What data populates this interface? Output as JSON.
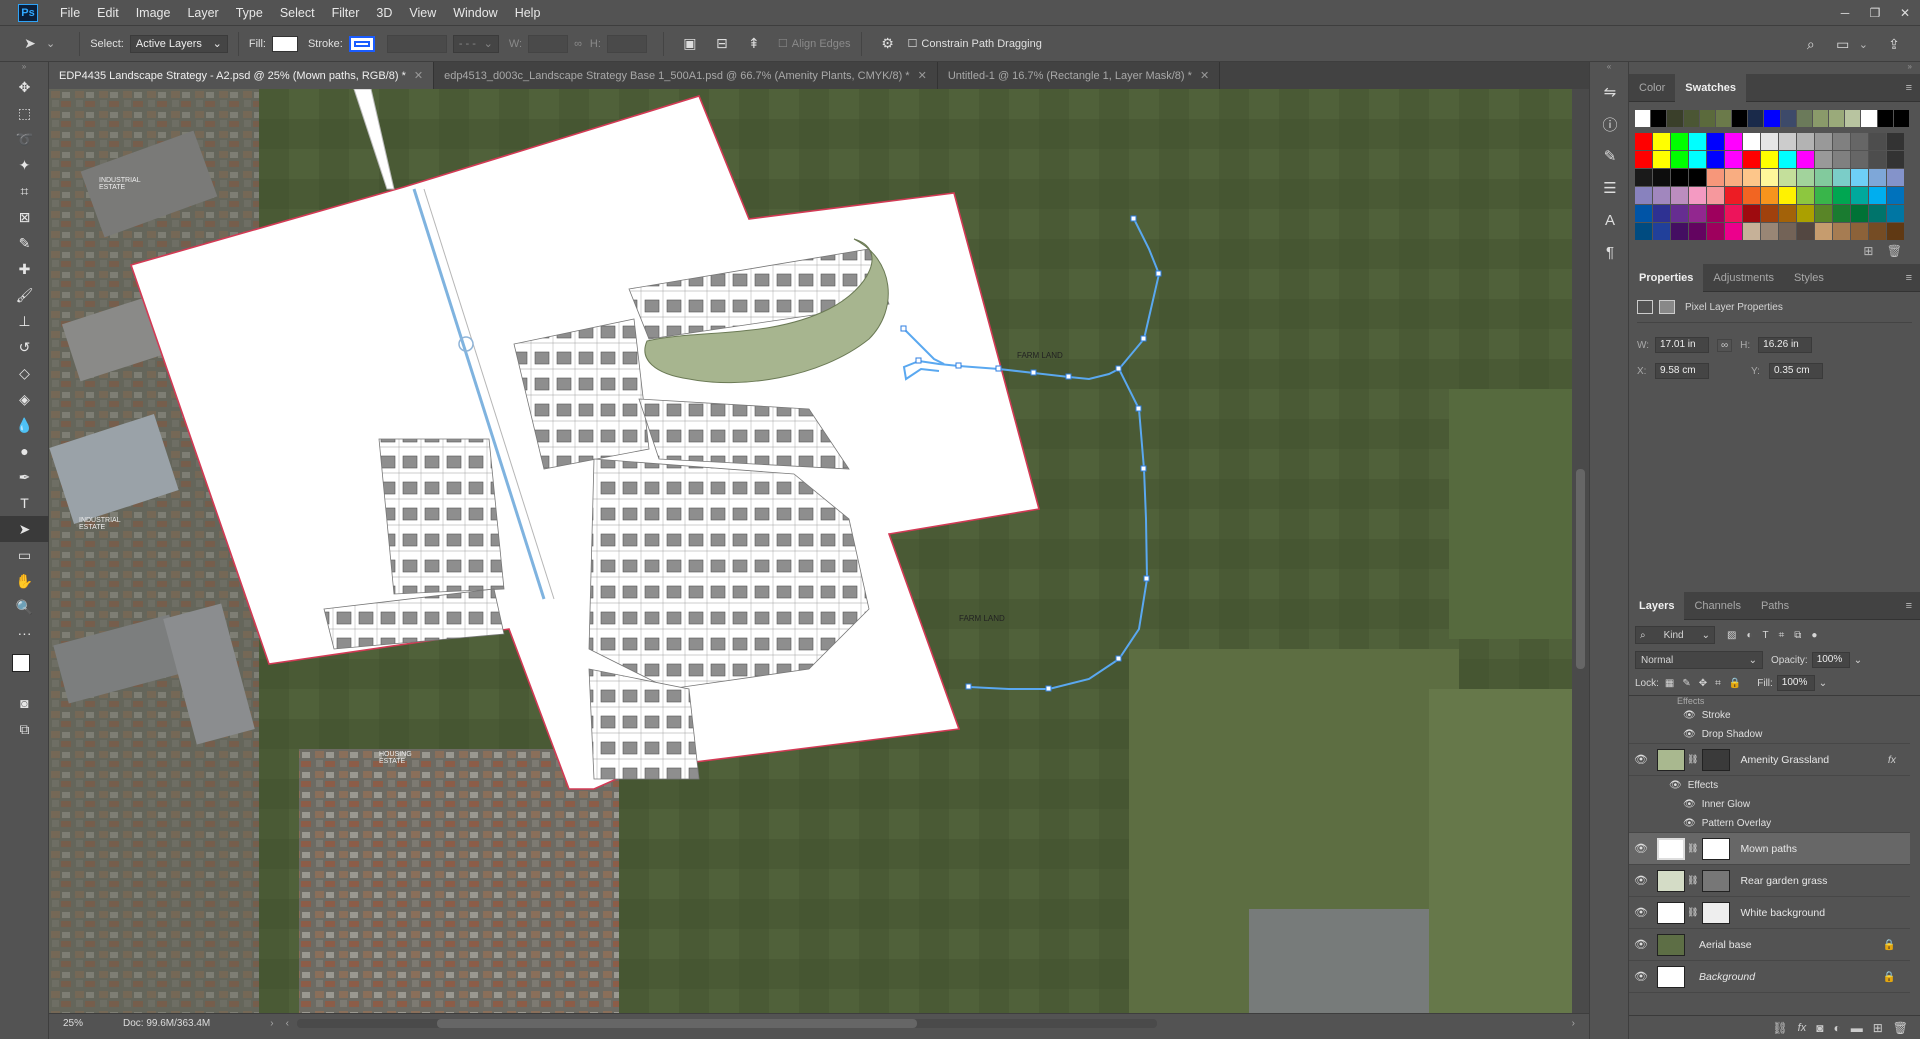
{
  "app": {
    "logo": "Ps",
    "menu": [
      "File",
      "Edit",
      "Image",
      "Layer",
      "Type",
      "Select",
      "Filter",
      "3D",
      "View",
      "Window",
      "Help"
    ]
  },
  "window_controls": {
    "minimize": "─",
    "restore": "❐",
    "close": "✕"
  },
  "options_bar": {
    "select_label": "Select:",
    "select_value": "Active Layers",
    "fill_label": "Fill:",
    "stroke_label": "Stroke:",
    "w_label": "W:",
    "h_label": "H:",
    "align_edges": "Align Edges",
    "constrain": "Constrain Path Dragging"
  },
  "tabs": [
    {
      "label": "EDP4435 Landscape Strategy - A2.psd @ 25% (Mown paths, RGB/8) *",
      "active": true
    },
    {
      "label": "edp4513_d003c_Landscape Strategy Base 1_500A1.psd @ 66.7% (Amenity Plants, CMYK/8) *",
      "active": false
    },
    {
      "label": "Untitled-1 @ 16.7% (Rectangle 1, Layer Mask/8) *",
      "active": false
    }
  ],
  "status": {
    "zoom": "25%",
    "doc": "Doc: 99.6M/363.4M"
  },
  "canvas_labels": {
    "farm_land_1": "FARM LAND",
    "farm_land_2": "FARM LAND",
    "industrial_1": "INDUSTRIAL ESTATE",
    "industrial_2": "INDUSTRIAL ESTATE",
    "housing": "HOUSING ESTATE"
  },
  "panel_top": {
    "tabs": [
      "Color",
      "Swatches"
    ],
    "active": "Swatches"
  },
  "swatches": {
    "row0": [
      "#ffffff",
      "#000000",
      "#3a3f2a",
      "#4b5634",
      "#5b6a3c",
      "#6b7a4a",
      "#000000",
      "#1a2a4a",
      "#0000ff",
      "#3d4a6a",
      "#6b7a5a",
      "#8a9a6a",
      "#9aaa7a",
      "#b8c4a0",
      "#ffffff",
      "#000000",
      "#000000"
    ],
    "row1": [
      "#ff0000",
      "#ffff00",
      "#00ff00",
      "#00ffff",
      "#0000ff",
      "#ff00ff",
      "#ffffff",
      "#e6e6e6",
      "#cccccc",
      "#b3b3b3",
      "#999999",
      "#808080",
      "#666666",
      "#4d4d4d",
      "#333333"
    ],
    "row2": [
      "#ff0000",
      "#ffff00",
      "#00ff00",
      "#00ffff",
      "#0000ff",
      "#ff00ff",
      "#ff0000",
      "#ffff00",
      "#00ffff",
      "#ff00ff",
      "#999999",
      "#808080",
      "#666666",
      "#4d4d4d",
      "#333333"
    ],
    "row3": [
      "#1a1a1a",
      "#0d0d0d",
      "#000000",
      "#000000",
      "#f7977a",
      "#f9ad81",
      "#fdc68a",
      "#fff79a",
      "#c4df9b",
      "#a2d39c",
      "#82ca9d",
      "#7bcdc8",
      "#6ecff6",
      "#7ea7d8",
      "#8493ca"
    ],
    "row4": [
      "#8882be",
      "#a187be",
      "#bc8dbf",
      "#f49ac2",
      "#f6989d",
      "#ed1c24",
      "#f26522",
      "#f7941d",
      "#fff200",
      "#8dc73f",
      "#39b54a",
      "#00a651",
      "#00a99d",
      "#00aeef",
      "#0072bc"
    ],
    "row5": [
      "#0054a6",
      "#2e3192",
      "#662d91",
      "#92278f",
      "#9e005d",
      "#ed145b",
      "#9e0b0f",
      "#a0410d",
      "#a36209",
      "#aba000",
      "#598527",
      "#1a7b30",
      "#007236",
      "#00746b",
      "#0076a3"
    ],
    "row6": [
      "#004b80",
      "#21409a",
      "#440e62",
      "#630460",
      "#9e005d",
      "#ec008c",
      "#c6b198",
      "#998675",
      "#736357",
      "#534741",
      "#c69c6e",
      "#a67c52",
      "#8c6239",
      "#754c24",
      "#603913"
    ]
  },
  "properties": {
    "tabs": [
      "Properties",
      "Adjustments",
      "Styles"
    ],
    "active": "Properties",
    "title": "Pixel Layer Properties",
    "w_label": "W:",
    "w": "17.01 in",
    "h_label": "H:",
    "h": "16.26 in",
    "x_label": "X:",
    "x": "9.58 cm",
    "y_label": "Y:",
    "y": "0.35 cm"
  },
  "layers_panel": {
    "tabs": [
      "Layers",
      "Channels",
      "Paths"
    ],
    "active": "Layers",
    "kind": "Kind",
    "blend": "Normal",
    "opacity_label": "Opacity:",
    "opacity": "100%",
    "lock_label": "Lock:",
    "fill_label": "Fill:",
    "fill": "100%",
    "effects_header": "Effects",
    "effects_stroke": "Stroke",
    "effects_dropshadow": "Drop Shadow",
    "amenity": "Amenity Grassland",
    "amenity_fx": "fx",
    "effects2": "Effects",
    "innerglow": "Inner Glow",
    "pattern": "Pattern Overlay",
    "mown": "Mown paths",
    "rear": "Rear garden grass",
    "white": "White background",
    "aerial": "Aerial base",
    "background": "Background"
  },
  "icons": {
    "eye": "👁",
    "lock": "🔒",
    "link": "🔗"
  }
}
